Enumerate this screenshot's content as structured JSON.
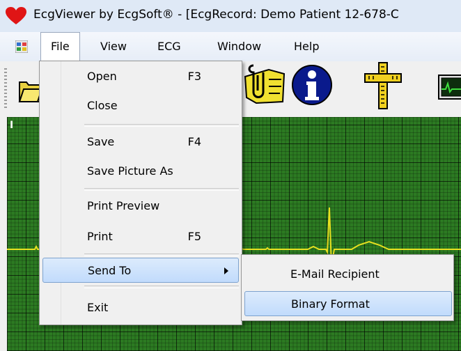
{
  "window": {
    "title": "EcgViewer by EcgSoft® - [EcgRecord: Demo Patient 12-678-C"
  },
  "menubar": {
    "items": [
      "File",
      "View",
      "ECG",
      "Window",
      "Help"
    ]
  },
  "canvas": {
    "lead_label": "I"
  },
  "file_menu": {
    "open": {
      "label": "Open",
      "shortcut": "F3"
    },
    "close": {
      "label": "Close"
    },
    "save": {
      "label": "Save",
      "shortcut": "F4"
    },
    "save_picture_as": {
      "label": "Save Picture As"
    },
    "print_preview": {
      "label": "Print Preview"
    },
    "print": {
      "label": "Print",
      "shortcut": "F5"
    },
    "send_to": {
      "label": "Send To"
    },
    "exit": {
      "label": "Exit"
    }
  },
  "send_to_menu": {
    "email": {
      "label": "E-Mail Recipient"
    },
    "binary": {
      "label": "Binary Format"
    }
  },
  "colors": {
    "grid_green": "#2c7a22",
    "trace_yellow": "#e8e020",
    "highlight": "#c1dbfc"
  }
}
